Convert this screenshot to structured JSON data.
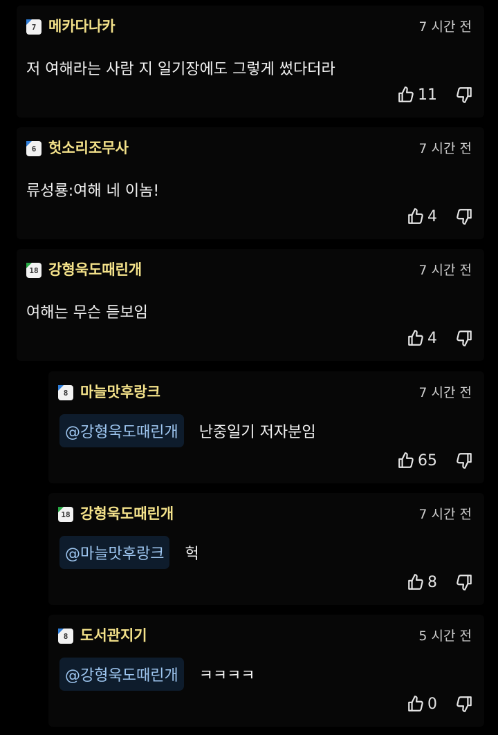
{
  "comments": [
    {
      "nickname": "메카다나카",
      "level": "7",
      "time": "7 시간 전",
      "mention": "",
      "text": "저 여해라는 사람 지 일기장에도 그렇게 썼다더라",
      "likes": "11",
      "reply": false,
      "badge_color": "#2e7dd8"
    },
    {
      "nickname": "헛소리조무사",
      "level": "6",
      "time": "7 시간 전",
      "mention": "",
      "text": "류성룡:여해 네 이놈!",
      "likes": "4",
      "reply": false,
      "badge_color": "#2e7dd8"
    },
    {
      "nickname": "강형욱도때린개",
      "level": "18",
      "time": "7 시간 전",
      "mention": "",
      "text": "여해는 무슨 듣보임",
      "likes": "4",
      "reply": false,
      "badge_color": "#27a844"
    },
    {
      "nickname": "마늘맛후랑크",
      "level": "8",
      "time": "7 시간 전",
      "mention": "@강형욱도때린개",
      "text": "난중일기 저자분임",
      "likes": "65",
      "reply": true,
      "badge_color": "#2e7dd8"
    },
    {
      "nickname": "강형욱도때린개",
      "level": "18",
      "time": "7 시간 전",
      "mention": "@마늘맛후랑크",
      "text": "헉",
      "likes": "8",
      "reply": true,
      "badge_color": "#27a844"
    },
    {
      "nickname": "도서관지기",
      "level": "8",
      "time": "5 시간 전",
      "mention": "@강형욱도때린개",
      "text": "ㅋㅋㅋㅋ",
      "likes": "0",
      "reply": true,
      "badge_color": "#2e7dd8"
    }
  ],
  "colors": {
    "background": "#000000",
    "nickname": "#f4e28a",
    "mention_text": "#9ec6f0",
    "mention_bg": "#0e1c2c"
  },
  "icons": {
    "like": "thumbs-up-icon",
    "dislike": "thumbs-down-icon"
  }
}
